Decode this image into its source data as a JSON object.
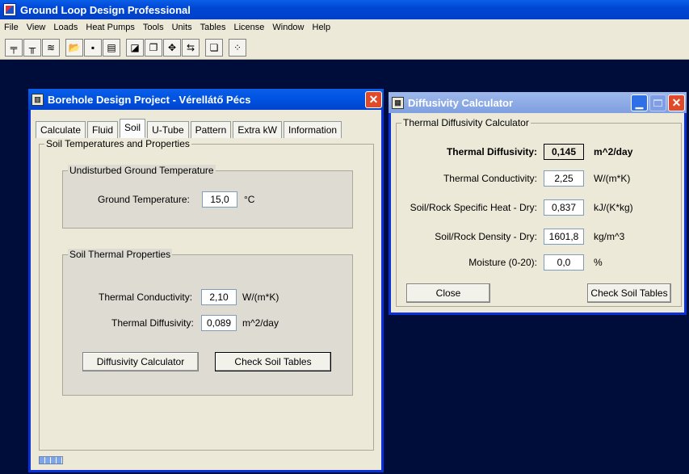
{
  "app": {
    "title": "Ground Loop Design Professional",
    "menu": [
      "File",
      "View",
      "Loads",
      "Heat Pumps",
      "Tools",
      "Units",
      "Tables",
      "License",
      "Window",
      "Help"
    ],
    "toolbar_icons": [
      "ghx-icon",
      "borehole-icon",
      "pond-icon",
      "open-icon",
      "save-icon",
      "print-icon",
      "edit-icon",
      "copy-icon",
      "grid-icon",
      "swap-icon",
      "duplicate-icon",
      "chart-icon"
    ]
  },
  "borehole": {
    "title": "Borehole Design Project - Vérellátő Pécs",
    "tabs": [
      "Calculate",
      "Fluid",
      "Soil",
      "U-Tube",
      "Pattern",
      "Extra kW",
      "Information"
    ],
    "active_tab": "Soil",
    "section_title": "Soil Temperatures and Properties",
    "ground_group": "Undisturbed Ground Temperature",
    "ground_temp_label": "Ground Temperature:",
    "ground_temp_value": "15,0",
    "ground_temp_unit": "°C",
    "thermal_group": "Soil Thermal Properties",
    "conductivity_label": "Thermal Conductivity:",
    "conductivity_value": "2,10",
    "conductivity_unit": "W/(m*K)",
    "diffusivity_label": "Thermal Diffusivity:",
    "diffusivity_value": "0,089",
    "diffusivity_unit": "m^2/day",
    "diffusivity_calc_button": "Diffusivity Calculator",
    "check_soil_button": "Check Soil Tables"
  },
  "diffusivity": {
    "title": "Diffusivity Calculator",
    "group_title": "Thermal Diffusivity Calculator",
    "result_label": "Thermal Diffusivity:",
    "result_value": "0,145",
    "result_unit": "m^2/day",
    "conductivity_label": "Thermal Conductivity:",
    "conductivity_value": "2,25",
    "conductivity_unit": "W/(m*K)",
    "specific_heat_label": "Soil/Rock Specific Heat - Dry:",
    "specific_heat_value": "0,837",
    "specific_heat_unit": "kJ/(K*kg)",
    "density_label": "Soil/Rock Density - Dry:",
    "density_value": "1601,8",
    "density_unit": "kg/m^3",
    "moisture_label": "Moisture (0-20):",
    "moisture_value": "0,0",
    "moisture_unit": "%",
    "close_button": "Close",
    "check_soil_button": "Check Soil Tables"
  }
}
